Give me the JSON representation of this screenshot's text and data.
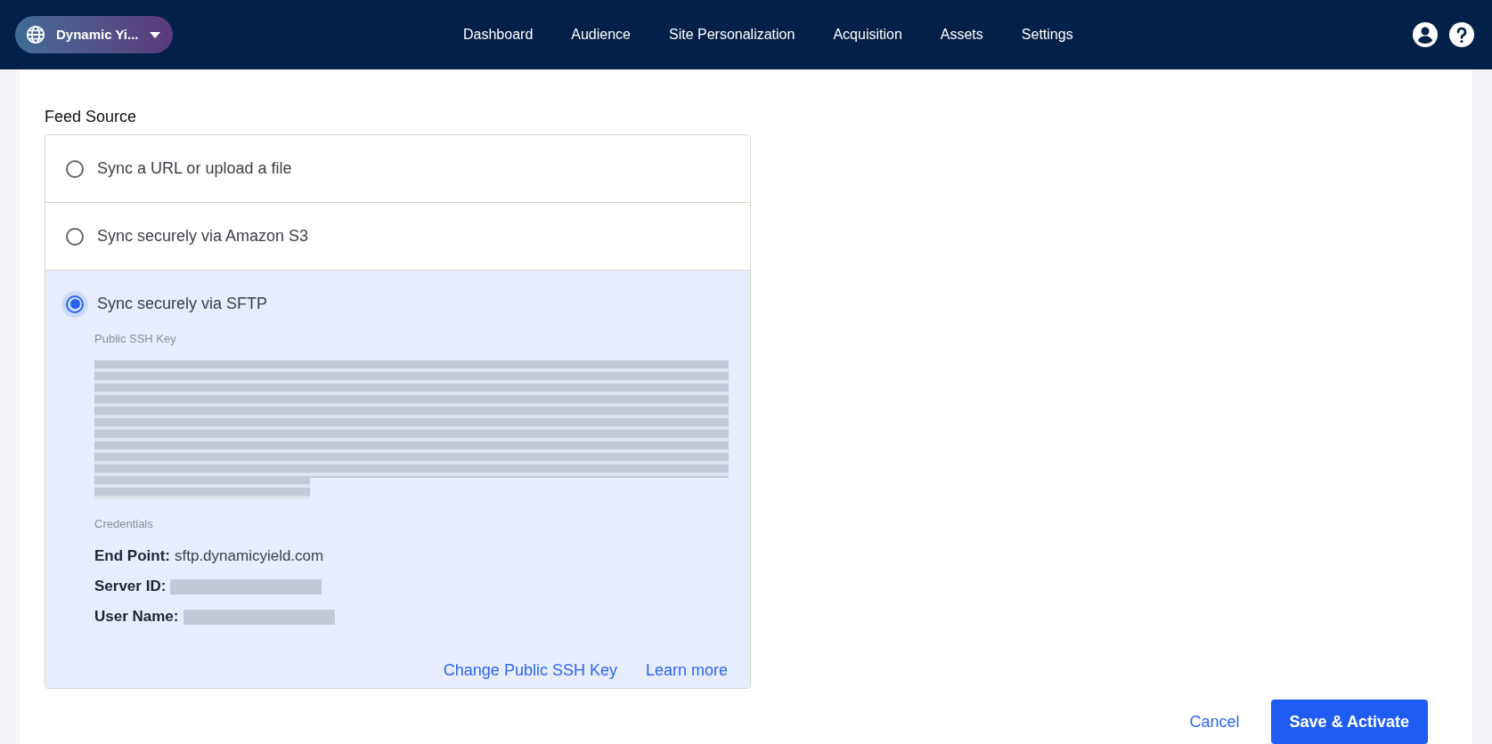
{
  "header": {
    "account": "Dynamic Yi...",
    "nav": [
      {
        "label": "Dashboard",
        "selected": false
      },
      {
        "label": "Audience",
        "selected": false
      },
      {
        "label": "Site Personalization",
        "selected": false
      },
      {
        "label": "Acquisition",
        "selected": false
      },
      {
        "label": "Assets",
        "selected": false
      },
      {
        "label": "Settings",
        "selected": false
      }
    ]
  },
  "feed_source": {
    "title": "Feed Source",
    "options": [
      {
        "label": "Sync a URL or upload a file",
        "selected": false
      },
      {
        "label": "Sync securely via Amazon S3",
        "selected": false
      },
      {
        "label": "Sync securely via SFTP",
        "selected": true
      }
    ],
    "sftp": {
      "key_label": "Public SSH Key",
      "credentials_label": "Credentials",
      "credentials": [
        {
          "label": "End Point:",
          "value": "sftp.dynamicyield.com",
          "redacted": false
        },
        {
          "label": "Server ID:",
          "redacted": true
        },
        {
          "label": "User Name:",
          "redacted": true
        }
      ],
      "links": [
        "Change Public SSH Key",
        "Learn more"
      ]
    }
  },
  "actions": {
    "cancel": "Cancel",
    "save": "Save & Activate"
  }
}
